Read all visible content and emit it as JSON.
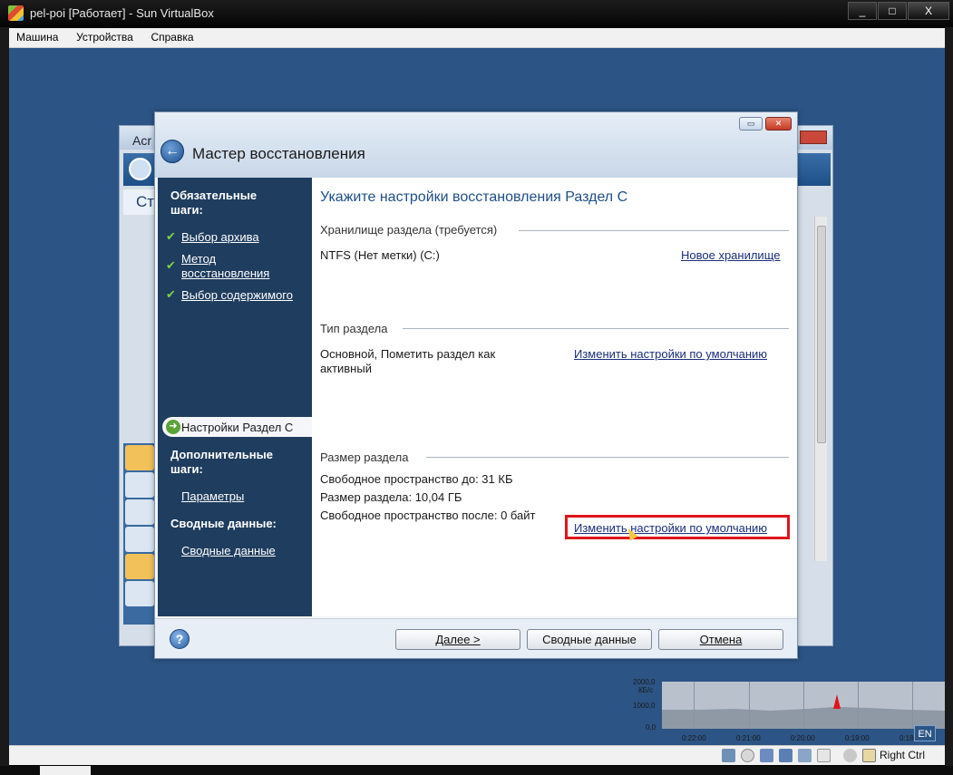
{
  "host": {
    "title": "pel-poi [Работает] - Sun VirtualBox",
    "menu": [
      "Машина",
      "Устройства",
      "Справка"
    ],
    "window_buttons": {
      "minimize": "_",
      "maximize": "□",
      "close": "X"
    },
    "status": {
      "host_key": "Right Ctrl"
    },
    "lang": "EN"
  },
  "background_window": {
    "title_fragment": "Acr",
    "heading_fragment": "Ст"
  },
  "wizard": {
    "title": "Мастер восстановления",
    "nav": {
      "required_heading": "Обязательные шаги:",
      "steps": [
        {
          "label": "Выбор архива",
          "done": true
        },
        {
          "label": "Метод восстановления",
          "done": true
        },
        {
          "label": "Выбор содержимого",
          "done": true
        }
      ],
      "current_step": "Настройки Раздел C",
      "optional_heading": "Дополнительные шаги:",
      "optional_steps": [
        "Параметры"
      ],
      "summary_heading": "Сводные данные:",
      "summary_steps": [
        "Сводные данные"
      ]
    },
    "content": {
      "heading": "Укажите настройки восстановления Раздел C",
      "storage": {
        "title": "Хранилище раздела (требуется)",
        "value": "NTFS (Нет метки) (C:)",
        "link": "Новое хранилище"
      },
      "partition_type": {
        "title": "Тип раздела",
        "value": "Основной, Пометить раздел как активный",
        "link": "Изменить настройки по умолчанию"
      },
      "partition_size": {
        "title": "Размер раздела",
        "lines": [
          "Свободное пространство до: 31 КБ",
          "Размер раздела: 10,04 ГБ",
          "Свободное пространство после: 0 байт"
        ],
        "link": "Изменить настройки по умолчанию"
      }
    },
    "buttons": {
      "next": "Далее >",
      "summary": "Сводные данные",
      "cancel": "Отмена"
    }
  },
  "perf_graph": {
    "y_labels": [
      "2000,0",
      "КБ/с",
      "1000,0",
      "0,0"
    ],
    "x_labels": [
      "0:22:00",
      "0:21:00",
      "0:20:00",
      "0:19:00",
      "0:18:0"
    ]
  },
  "colors": {
    "desktop": "#2c5485",
    "wizard_nav": "#1f3d5e",
    "highlight": "#e0141b",
    "link": "#1a2e7a"
  }
}
